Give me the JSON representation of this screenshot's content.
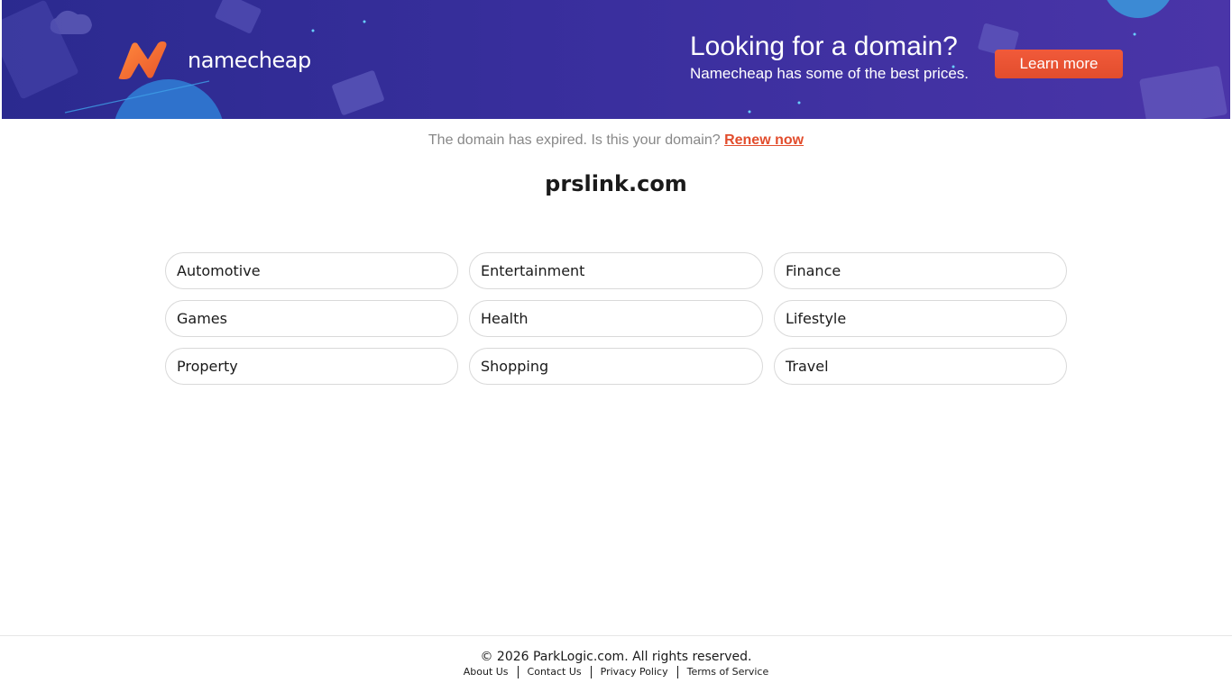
{
  "banner": {
    "logo_text": "namecheap",
    "promo_title": "Looking for a domain?",
    "promo_subtitle": "Namecheap has some of the best prices.",
    "learn_more_label": "Learn more",
    "colors": {
      "background_start": "#2b2a8f",
      "background_end": "#4a35a8",
      "brand_orange": "#f15a3a"
    }
  },
  "notice": {
    "text": "The domain has expired. Is this your domain?",
    "renew_label": "Renew now"
  },
  "domain": {
    "name": "prslink.com"
  },
  "categories": [
    "Automotive",
    "Entertainment",
    "Finance",
    "Games",
    "Health",
    "Lifestyle",
    "Property",
    "Shopping",
    "Travel"
  ],
  "footer": {
    "copyright": "© 2026 ParkLogic.com. All rights reserved.",
    "links": [
      "About Us",
      "Contact Us",
      "Privacy Policy",
      "Terms of Service"
    ]
  }
}
